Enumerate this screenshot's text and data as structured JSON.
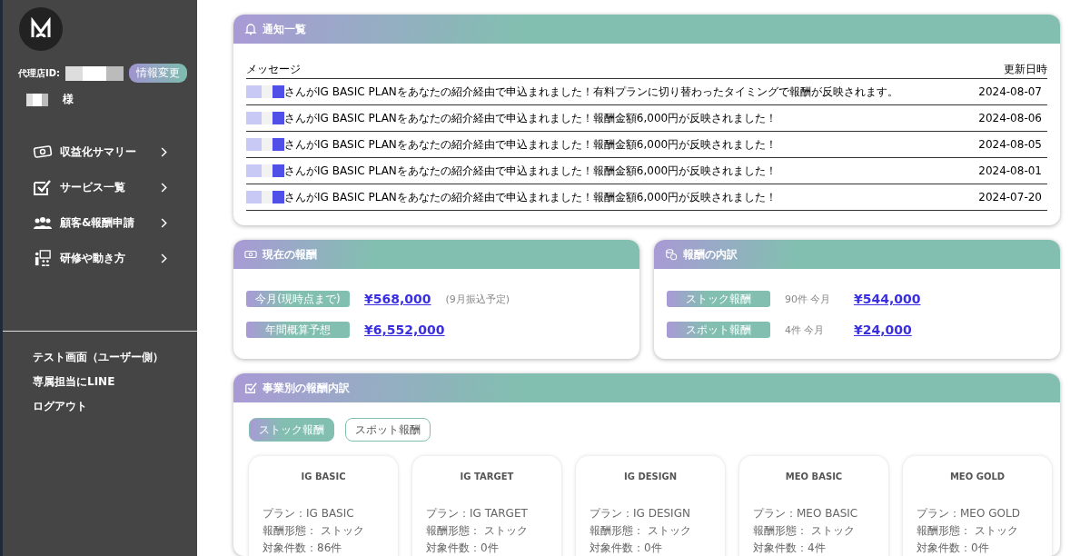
{
  "sidebar": {
    "agency_id_label": "代理店ID:",
    "edit_button": "情報変更",
    "honorific": "様",
    "nav": [
      {
        "label": "収益化サマリー"
      },
      {
        "label": "サービス一覧"
      },
      {
        "label": "顧客&報酬申請"
      },
      {
        "label": "研修や動き方"
      }
    ],
    "links": [
      "テスト画面（ユーザー側）",
      "専属担当にLINE",
      "ログアウト"
    ]
  },
  "notices": {
    "title": "通知一覧",
    "columns": [
      "メッセージ",
      "更新日時"
    ],
    "rows": [
      {
        "message": "さんがIG BASIC PLANをあなたの紹介経由で申込まれました！有料プランに切り替わったタイミングで報酬が反映されます。",
        "date": "2024-08-07"
      },
      {
        "message": "さんがIG BASIC PLANをあなたの紹介経由で申込まれました！報酬金額6,000円が反映されました！",
        "date": "2024-08-06"
      },
      {
        "message": "さんがIG BASIC PLANをあなたの紹介経由で申込まれました！報酬金額6,000円が反映されました！",
        "date": "2024-08-05"
      },
      {
        "message": "さんがIG BASIC PLANをあなたの紹介経由で申込まれました！報酬金額6,000円が反映されました！",
        "date": "2024-08-01"
      },
      {
        "message": "さんがIG BASIC PLANをあなたの紹介経由で申込まれました！報酬金額6,000円が反映されました！",
        "date": "2024-07-20"
      }
    ]
  },
  "current_reward": {
    "title": "現在の報酬",
    "rows": [
      {
        "label": "今月(現時点まで)",
        "amount": "¥568,000",
        "note": "(9月振込予定)"
      },
      {
        "label": "年間概算予想",
        "amount": "¥6,552,000"
      }
    ]
  },
  "breakdown": {
    "title": "報酬の内訳",
    "rows": [
      {
        "label": "ストック報酬",
        "note": "90件 今月",
        "amount": "¥544,000"
      },
      {
        "label": "スポット報酬",
        "note": "4件 今月",
        "amount": "¥24,000"
      }
    ]
  },
  "by_business": {
    "title": "事業別の報酬内訳",
    "tabs": [
      {
        "label": "ストック報酬",
        "selected": true
      },
      {
        "label": "スポット報酬",
        "selected": false
      }
    ],
    "cards": [
      {
        "name": "IG BASIC",
        "plan": "プラン：IG BASIC",
        "type": "報酬形態： ストック",
        "count": "対象件数：86件"
      },
      {
        "name": "IG TARGET",
        "plan": "プラン：IG TARGET",
        "type": "報酬形態： ストック",
        "count": "対象件数：0件"
      },
      {
        "name": "IG DESIGN",
        "plan": "プラン：IG DESIGN",
        "type": "報酬形態： ストック",
        "count": "対象件数：0件"
      },
      {
        "name": "MEO BASIC",
        "plan": "プラン：MEO BASIC",
        "type": "報酬形態： ストック",
        "count": "対象件数：4件"
      },
      {
        "name": "MEO GOLD",
        "plan": "プラン：MEO GOLD",
        "type": "報酬形態： ストック",
        "count": "対象件数：0件"
      }
    ]
  }
}
